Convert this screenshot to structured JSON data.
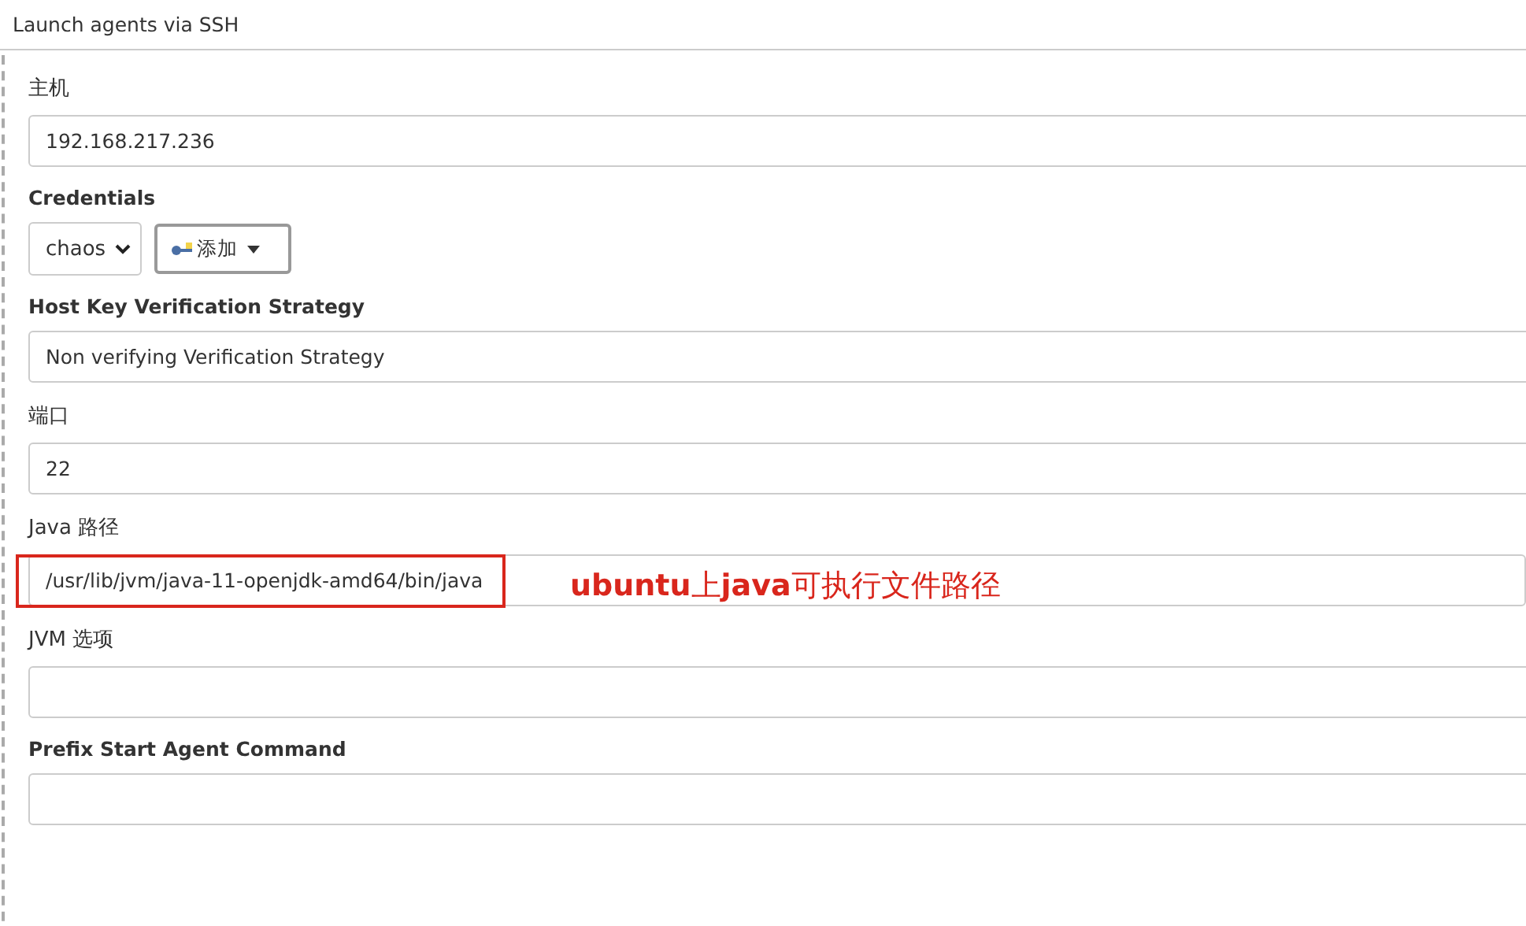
{
  "section": {
    "title": "Launch agents via SSH"
  },
  "fields": [
    {
      "kind": "text",
      "label": "主机",
      "value": "192.168.217.236"
    },
    {
      "kind": "credentials",
      "label": "Credentials",
      "value": "chaos",
      "button": "添加"
    },
    {
      "kind": "select",
      "label": "Host Key Verification Strategy",
      "value": "Non verifying Verification Strategy"
    },
    {
      "kind": "text",
      "label": "端口",
      "value": "22"
    },
    {
      "kind": "text",
      "label": "Java 路径",
      "value": "/usr/lib/jvm/java-11-openjdk-amd64/bin/java",
      "highlighted": true,
      "note": "**ubuntu**上**java**可执行文件路径"
    },
    {
      "kind": "text",
      "label": "JVM 选项"
    },
    {
      "kind": "text",
      "label": "Prefix Start Agent Command"
    }
  ]
}
